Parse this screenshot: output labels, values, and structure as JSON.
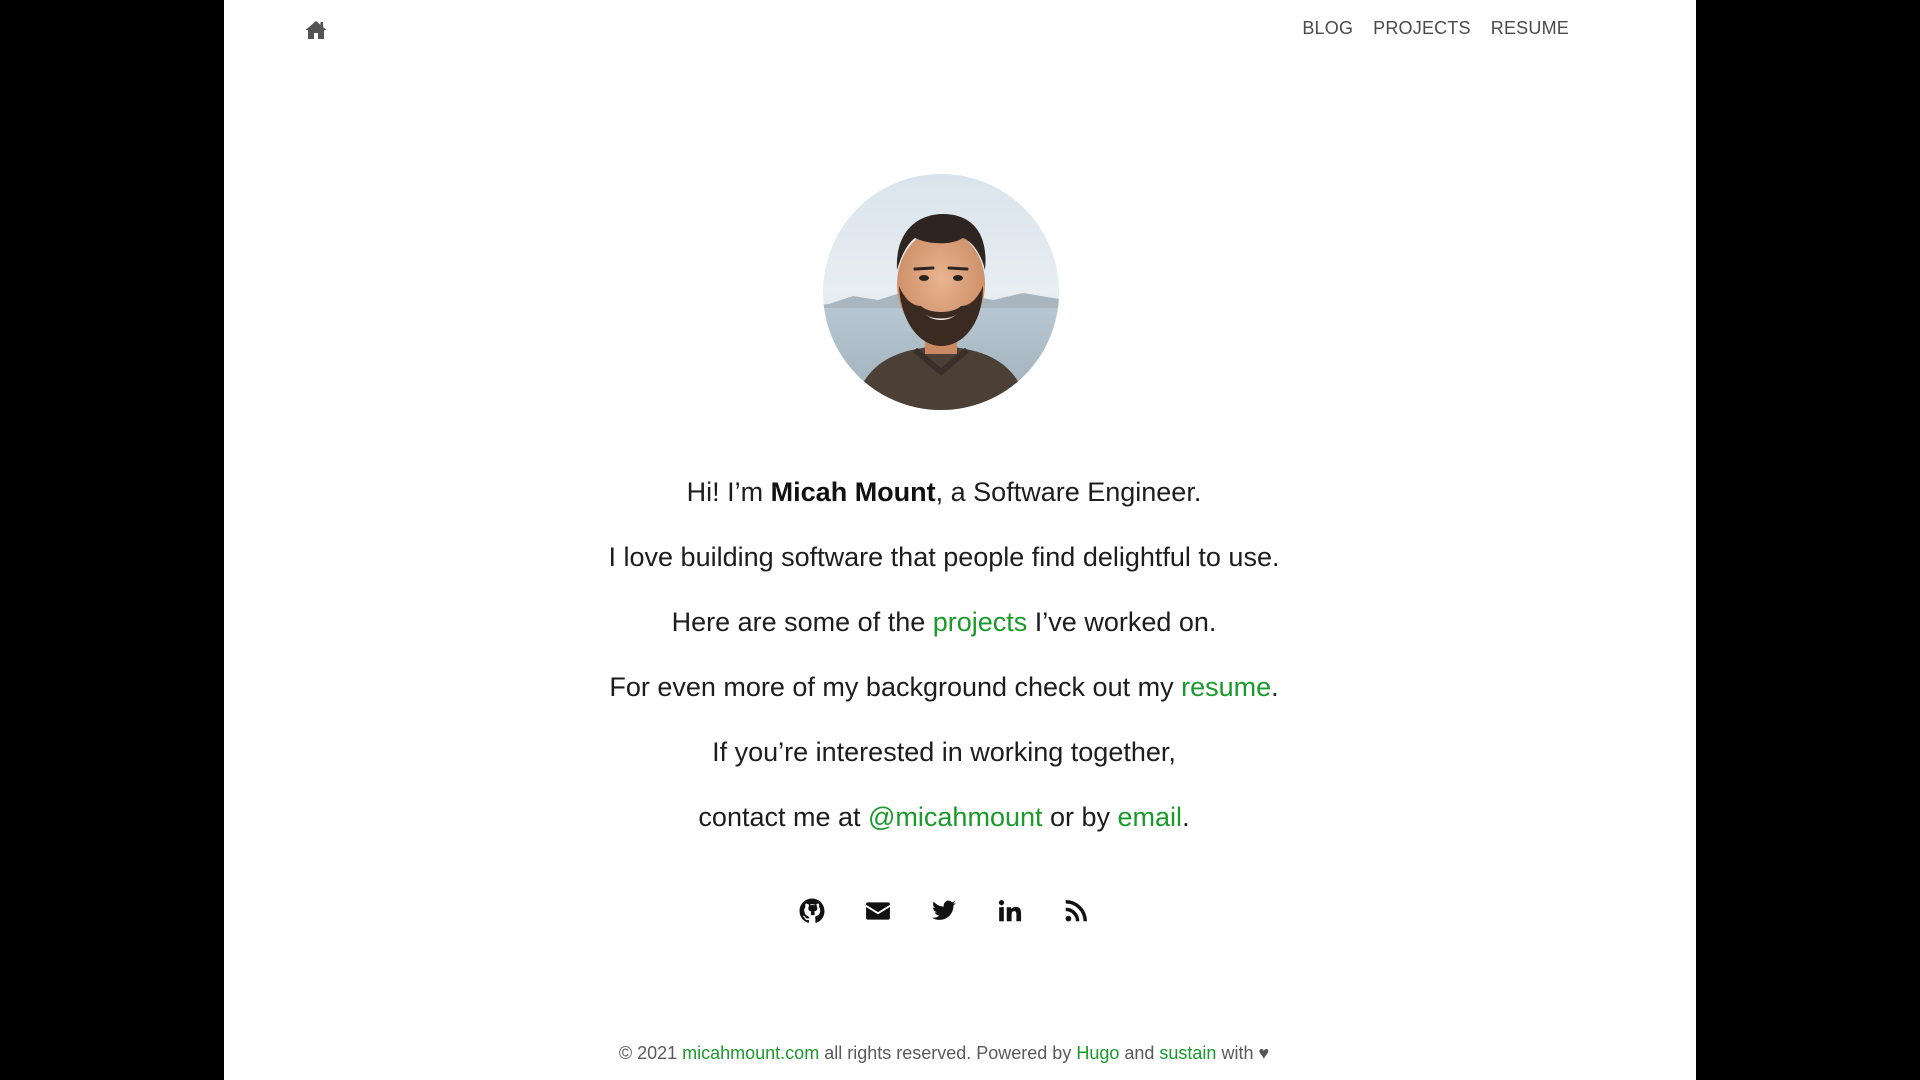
{
  "header": {
    "home_icon": "home-icon",
    "nav": [
      {
        "label": "BLOG"
      },
      {
        "label": "PROJECTS"
      },
      {
        "label": "RESUME"
      }
    ]
  },
  "avatar": {
    "alt": "Micah Mount"
  },
  "intro": {
    "line1_prefix": "Hi! I’m ",
    "line1_name": "Micah Mount",
    "line1_suffix": ", a Software Engineer.",
    "line2": "I love building software that people find delightful to use.",
    "line3_prefix": "Here are some of the ",
    "line3_link": "projects",
    "line3_suffix": " I’ve worked on.",
    "line4_prefix": "For even more of my background check out my ",
    "line4_link": "resume",
    "line4_suffix": ".",
    "line5": "If you’re interested in working together,",
    "line6_prefix": "contact me at ",
    "line6_link1": "@micahmount",
    "line6_middle": " or by ",
    "line6_link2": "email",
    "line6_suffix": "."
  },
  "social": [
    {
      "icon": "github-icon"
    },
    {
      "icon": "email-icon"
    },
    {
      "icon": "twitter-icon"
    },
    {
      "icon": "linkedin-icon"
    },
    {
      "icon": "rss-icon"
    }
  ],
  "footer": {
    "copyright": "© 2021 ",
    "site_link": "micahmount.com",
    "text1": " all rights reserved. Powered by ",
    "hugo_link": "Hugo",
    "text2": " and ",
    "sustain_link": "sustain",
    "text3": " with ",
    "heart": "♥"
  },
  "colors": {
    "accent": "#1a9a2b",
    "text": "#1d1d1d",
    "nav": "#4a4a4a",
    "background": "#ffffff",
    "letterbox": "#000000"
  }
}
